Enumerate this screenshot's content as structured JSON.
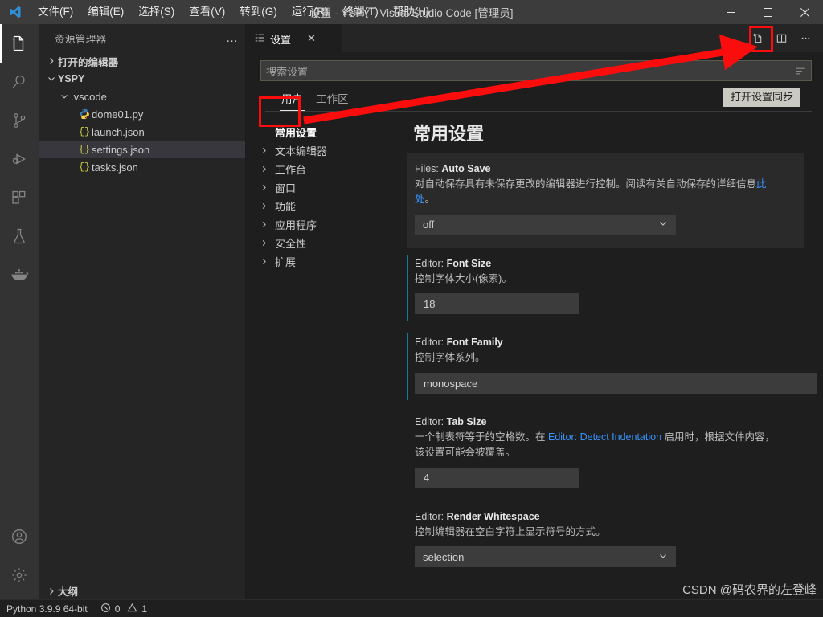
{
  "window": {
    "title": "设置 - YSPY - Visual Studio Code [管理员]",
    "minimize": "—",
    "maximize": "□",
    "close": "✕"
  },
  "menubar": {
    "items": [
      {
        "label": "文件(F)",
        "name": "menu-file"
      },
      {
        "label": "编辑(E)",
        "name": "menu-edit"
      },
      {
        "label": "选择(S)",
        "name": "menu-selection"
      },
      {
        "label": "查看(V)",
        "name": "menu-view"
      },
      {
        "label": "转到(G)",
        "name": "menu-go"
      },
      {
        "label": "运行(R)",
        "name": "menu-run"
      },
      {
        "label": "终端(T)",
        "name": "menu-terminal"
      },
      {
        "label": "帮助(H)",
        "name": "menu-help"
      }
    ]
  },
  "activitybar": {
    "items": [
      {
        "icon": "explorer-icon",
        "active": true
      },
      {
        "icon": "search-icon",
        "active": false
      },
      {
        "icon": "source-control-icon",
        "active": false
      },
      {
        "icon": "run-debug-icon",
        "active": false
      },
      {
        "icon": "extensions-icon",
        "active": false
      },
      {
        "icon": "testing-flask-icon",
        "active": false
      },
      {
        "icon": "docker-whale-icon",
        "active": false
      }
    ],
    "bottom": [
      {
        "icon": "account-icon"
      },
      {
        "icon": "gear-icon"
      }
    ]
  },
  "sidebar": {
    "title": "资源管理器",
    "more_label": "…",
    "tree": [
      {
        "label": "打开的编辑器",
        "indent": 0,
        "twisty": "collapsed",
        "bold": true,
        "icon": "none",
        "selected": false
      },
      {
        "label": "YSPY",
        "indent": 0,
        "twisty": "expanded",
        "bold": true,
        "icon": "none",
        "selected": false
      },
      {
        "label": ".vscode",
        "indent": 1,
        "twisty": "expanded",
        "bold": false,
        "icon": "none",
        "selected": false
      },
      {
        "label": "dome01.py",
        "indent": 2,
        "twisty": "none",
        "bold": false,
        "icon": "python-icon",
        "selected": false
      },
      {
        "label": "launch.json",
        "indent": 2,
        "twisty": "none",
        "bold": false,
        "icon": "json-icon",
        "selected": false
      },
      {
        "label": "settings.json",
        "indent": 2,
        "twisty": "none",
        "bold": false,
        "icon": "json-icon",
        "selected": true
      },
      {
        "label": "tasks.json",
        "indent": 2,
        "twisty": "none",
        "bold": false,
        "icon": "json-icon",
        "selected": false
      }
    ],
    "outline_label": "大纲"
  },
  "editor": {
    "tab_label": "设置",
    "tab_close": "✕",
    "actions": [
      {
        "icon": "open-settings-json-icon",
        "highlighted": true
      },
      {
        "icon": "split-editor-icon",
        "highlighted": false
      },
      {
        "icon": "more-actions-icon",
        "highlighted": false
      }
    ]
  },
  "settings": {
    "search_placeholder": "搜索设置",
    "search_value": "",
    "filter_icon": "filter-icon",
    "scope_tabs": [
      {
        "label": "用户",
        "active": true
      },
      {
        "label": "工作区",
        "active": false
      }
    ],
    "sync_button": "打开设置同步",
    "toc": [
      {
        "label": "常用设置",
        "selected": true
      },
      {
        "label": "文本编辑器",
        "selected": false
      },
      {
        "label": "工作台",
        "selected": false
      },
      {
        "label": "窗口",
        "selected": false
      },
      {
        "label": "功能",
        "selected": false
      },
      {
        "label": "应用程序",
        "selected": false
      },
      {
        "label": "安全性",
        "selected": false
      },
      {
        "label": "扩展",
        "selected": false
      }
    ],
    "page_title": "常用设置",
    "items": [
      {
        "prefix": "Files: ",
        "key": "Auto Save",
        "desc_before": "对自动保存具有未保存更改的编辑器进行控制。阅读有关自动保存的详细信息",
        "link": "此处",
        "desc_after": "。",
        "control": "select",
        "value": "off",
        "modified": false,
        "hovered": true
      },
      {
        "prefix": "Editor: ",
        "key": "Font Size",
        "desc_before": "控制字体大小(像素)。",
        "link": "",
        "desc_after": "",
        "control": "input",
        "value": "18",
        "modified": true,
        "hovered": false
      },
      {
        "prefix": "Editor: ",
        "key": "Font Family",
        "desc_before": "控制字体系列。",
        "link": "",
        "desc_after": "",
        "control": "input-wide",
        "value": "monospace",
        "modified": true,
        "hovered": false
      },
      {
        "prefix": "Editor: ",
        "key": "Tab Size",
        "desc_before": "一个制表符等于的空格数。在 ",
        "link": "Editor: Detect Indentation",
        "desc_after": " 启用时，根据文件内容，该设置可能会被覆盖。",
        "control": "input",
        "value": "4",
        "modified": false,
        "hovered": false
      },
      {
        "prefix": "Editor: ",
        "key": "Render Whitespace",
        "desc_before": "控制编辑器在空白字符上显示符号的方式。",
        "link": "",
        "desc_after": "",
        "control": "select",
        "value": "selection",
        "modified": false,
        "hovered": false
      }
    ]
  },
  "statusbar": {
    "python": "Python 3.9.9 64-bit",
    "errors": "0",
    "warnings": "1",
    "error_icon": "error-circle-icon",
    "warning_icon": "warning-triangle-icon"
  },
  "annotations": {
    "watermark": "CSDN @码农界的左登峰",
    "color": "#fb0d0d"
  }
}
